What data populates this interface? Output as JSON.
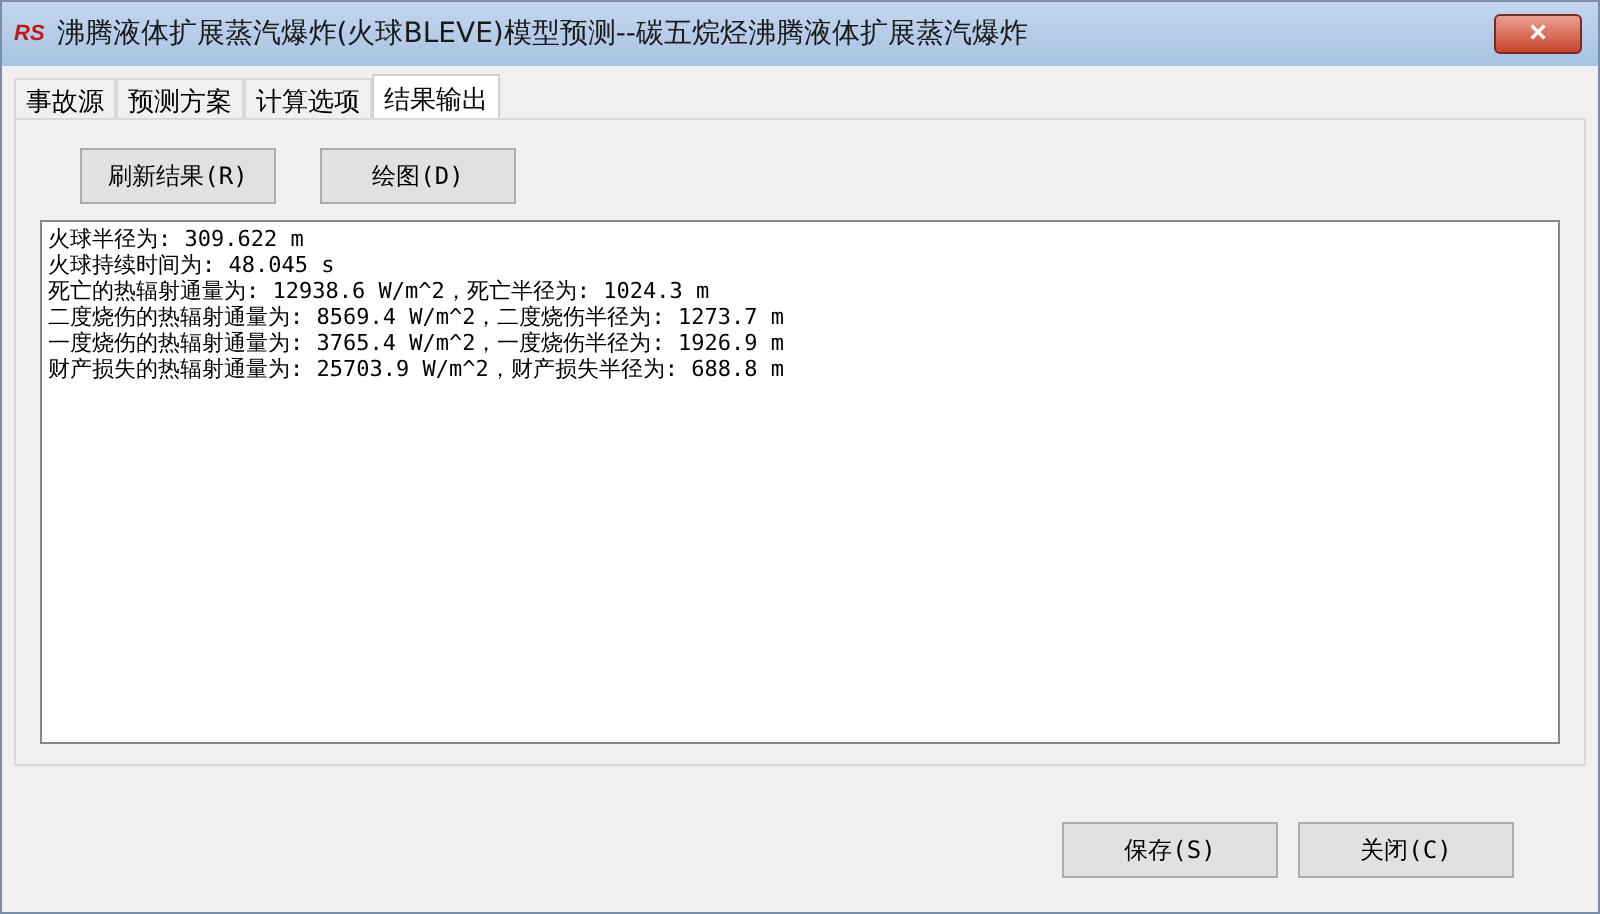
{
  "window": {
    "logo": "RS",
    "title": "沸腾液体扩展蒸汽爆炸(火球BLEVE)模型预测--碳五烷烃沸腾液体扩展蒸汽爆炸",
    "close": "×"
  },
  "tabs": [
    {
      "label": "事故源",
      "selected": false
    },
    {
      "label": "预测方案",
      "selected": false
    },
    {
      "label": "计算选项",
      "selected": false
    },
    {
      "label": "结果输出",
      "selected": true
    }
  ],
  "toolbar_buttons": [
    "刷新结果(R)",
    "绘图(D)"
  ],
  "output_lines": [
    "火球半径为: 309.622 m",
    "火球持续时间为: 48.045 s",
    "死亡的热辐射通量为: 12938.6 W/m^2，死亡半径为: 1024.3 m",
    "二度烧伤的热辐射通量为: 8569.4 W/m^2，二度烧伤半径为: 1273.7 m",
    "一度烧伤的热辐射通量为: 3765.4 W/m^2，一度烧伤半径为: 1926.9 m",
    "财产损失的热辐射通量为: 25703.9 W/m^2，财产损失半径为: 688.8 m"
  ],
  "footer_buttons": [
    "保存(S)",
    "关闭(C)"
  ]
}
